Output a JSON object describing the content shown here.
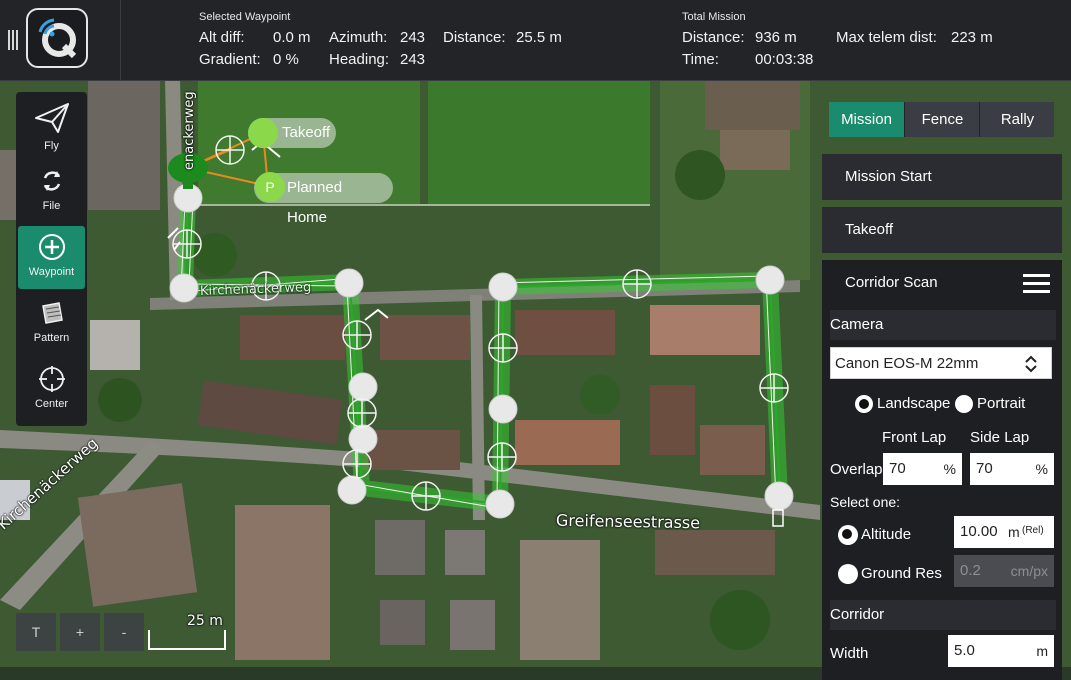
{
  "header": {
    "selected_waypoint": {
      "title": "Selected Waypoint",
      "alt_diff_label": "Alt diff:",
      "alt_diff_value": "0.0 m",
      "azimuth_label": "Azimuth:",
      "azimuth_value": "243",
      "distance_label": "Distance:",
      "distance_value": "25.5 m",
      "gradient_label": "Gradient:",
      "gradient_value": "0 %",
      "heading_label": "Heading:",
      "heading_value": "243"
    },
    "total_mission": {
      "title": "Total Mission",
      "distance_label": "Distance:",
      "distance_value": "936 m",
      "time_label": "Time:",
      "time_value": "00:03:38",
      "max_telem_label": "Max telem dist:",
      "max_telem_value": "223 m"
    }
  },
  "toolstrip": {
    "items": [
      {
        "label": "Fly",
        "icon": "paper-plane-icon"
      },
      {
        "label": "File",
        "icon": "sync-icon"
      },
      {
        "label": "Waypoint",
        "icon": "plus-circle-icon",
        "active": true
      },
      {
        "label": "Pattern",
        "icon": "pattern-icon"
      },
      {
        "label": "Center",
        "icon": "crosshair-icon"
      }
    ]
  },
  "panel": {
    "tabs": [
      "Mission",
      "Fence",
      "Rally"
    ],
    "active_tab": "Mission",
    "items": [
      "Mission Start",
      "Takeoff"
    ],
    "corridor_scan": {
      "title": "Corridor Scan",
      "camera_section": "Camera",
      "camera_value": "Canon EOS-M 22mm",
      "landscape_label": "Landscape",
      "portrait_label": "Portrait",
      "orientation": "Landscape",
      "front_lap_label": "Front Lap",
      "side_lap_label": "Side Lap",
      "overlap_label": "Overlap",
      "front_lap_value": "70",
      "side_lap_value": "70",
      "percent": "%",
      "select_one_label": "Select one:",
      "altitude_label": "Altitude",
      "altitude_value": "10.00",
      "altitude_unit": "m",
      "altitude_ref": "(Rel)",
      "ground_res_label": "Ground Res",
      "ground_res_value": "0.2",
      "ground_res_unit": "cm/px",
      "corridor_section": "Corridor",
      "width_label": "Width",
      "width_value": "5.0",
      "width_unit": "m"
    }
  },
  "map": {
    "takeoff_label": "Takeoff",
    "planned_home_label": "Planned Home",
    "home_marker_letter": "P",
    "street_labels": [
      "Kirchenäckerweg",
      "Greifenseestrasse",
      "Kirchenäckerweg",
      "enackerweg"
    ],
    "scale_label": "25 m",
    "zoom_buttons": [
      "T",
      "+",
      "-"
    ]
  },
  "colors": {
    "accent": "#1a8b6c",
    "toolbar_bg": "#232428",
    "panel_bg": "#1e1f23",
    "corridor_green": "#3fd23f",
    "takeoff_marker": "#8bd94a",
    "vehicle_marker": "#1d8a1d"
  }
}
